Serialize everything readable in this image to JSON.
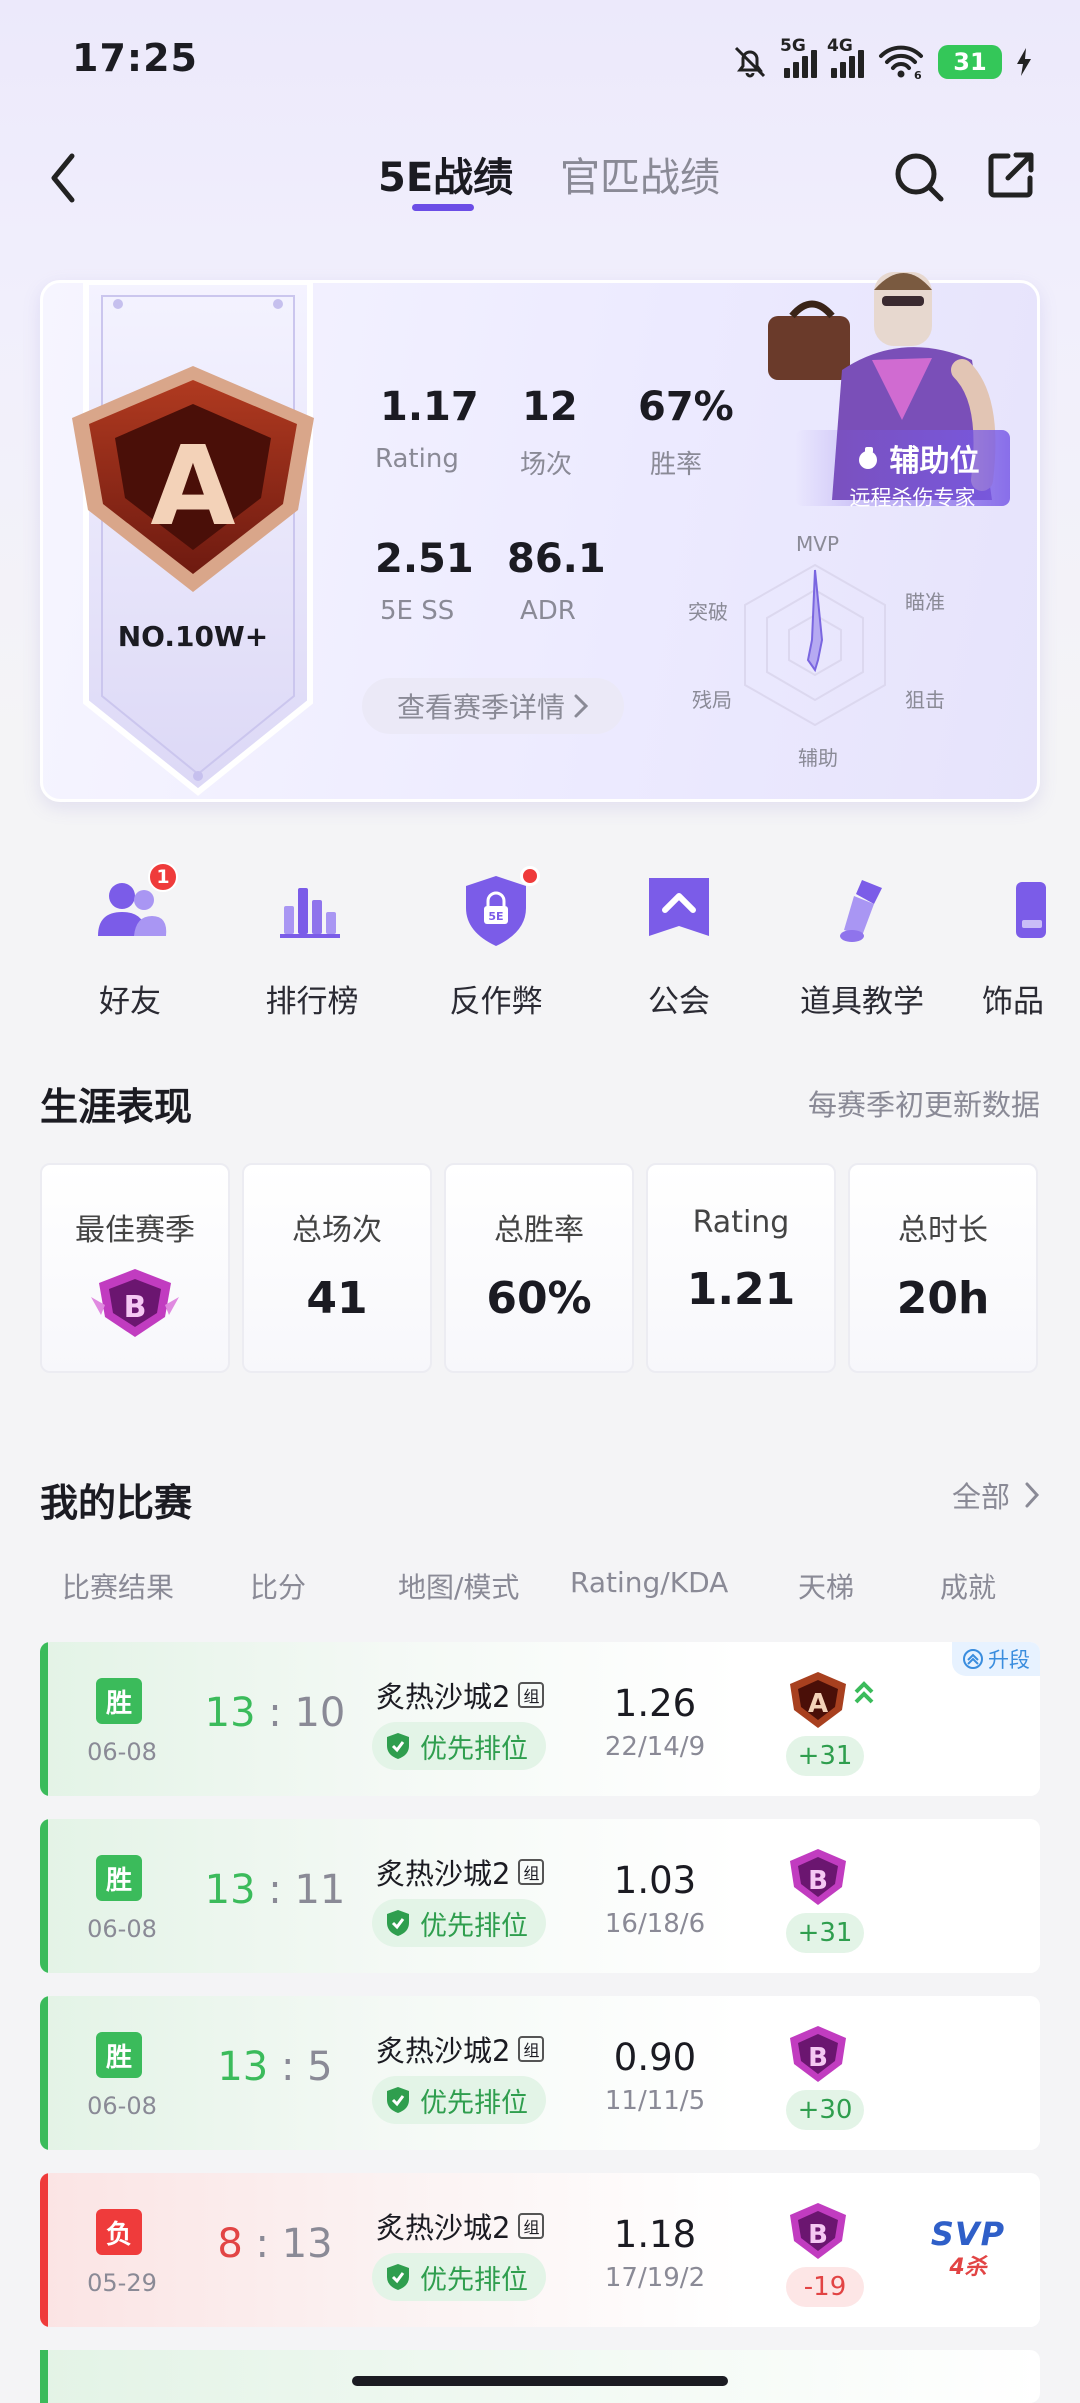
{
  "status_bar": {
    "time": "17:25",
    "signal1": "5G",
    "signal2": "4G",
    "wifi_sub": "6",
    "battery": "31"
  },
  "header": {
    "tabs": [
      {
        "label": "5E战绩",
        "active": true
      },
      {
        "label": "官匹战绩",
        "active": false
      }
    ]
  },
  "profile": {
    "rank_letter": "A",
    "rank_position": "NO.10W+",
    "stats": [
      {
        "value": "1.17",
        "label": "Rating"
      },
      {
        "value": "12",
        "label": "场次"
      },
      {
        "value": "67%",
        "label": "胜率"
      },
      {
        "value": "2.51",
        "label": "5E SS"
      },
      {
        "value": "86.1",
        "label": "ADR"
      }
    ],
    "detail_button": "查看赛季详情",
    "role": {
      "title": "辅助位",
      "subtitle": "远程杀伤专家"
    },
    "radar_labels": [
      "MVP",
      "瞄准",
      "狙击",
      "辅助",
      "残局",
      "突破"
    ]
  },
  "quick_menu": [
    {
      "label": "好友",
      "icon": "friends-icon",
      "badge": "1"
    },
    {
      "label": "排行榜",
      "icon": "leaderboard-icon"
    },
    {
      "label": "反作弊",
      "icon": "anti-cheat-shield-icon",
      "dot": true,
      "icon_text": "5E"
    },
    {
      "label": "公会",
      "icon": "guild-icon"
    },
    {
      "label": "道具教学",
      "icon": "grenade-icon"
    },
    {
      "label": "饰品",
      "icon": "skins-icon"
    }
  ],
  "career": {
    "title": "生涯表现",
    "note": "每赛季初更新数据",
    "cards": [
      {
        "title": "最佳赛季",
        "badge": "B"
      },
      {
        "title": "总场次",
        "value": "41"
      },
      {
        "title": "总胜率",
        "value": "60%"
      },
      {
        "title": "Rating",
        "value": "1.21"
      },
      {
        "title": "总时长",
        "value": "20h"
      }
    ]
  },
  "matches": {
    "title": "我的比赛",
    "all_link": "全部",
    "columns": [
      "比赛结果",
      "比分",
      "地图/模式",
      "Rating/KDA",
      "天梯",
      "成就"
    ],
    "rows": [
      {
        "result": "胜",
        "date": "06-08",
        "score_a": "13",
        "score_b": "10",
        "map": "炙热沙城2",
        "group": "组",
        "mode": "优先排位",
        "rating": "1.26",
        "kda": "22/14/9",
        "rank_badge": "A",
        "points": "+31",
        "promo": "升段"
      },
      {
        "result": "胜",
        "date": "06-08",
        "score_a": "13",
        "score_b": "11",
        "map": "炙热沙城2",
        "group": "组",
        "mode": "优先排位",
        "rating": "1.03",
        "kda": "16/18/6",
        "rank_badge": "B",
        "points": "+31"
      },
      {
        "result": "胜",
        "date": "06-08",
        "score_a": "13",
        "score_b": "5",
        "map": "炙热沙城2",
        "group": "组",
        "mode": "优先排位",
        "rating": "0.90",
        "kda": "11/11/5",
        "rank_badge": "B",
        "points": "+30"
      },
      {
        "result": "负",
        "date": "05-29",
        "score_a": "8",
        "score_b": "13",
        "map": "炙热沙城2",
        "group": "组",
        "mode": "优先排位",
        "rating": "1.18",
        "kda": "17/19/2",
        "rank_badge": "B",
        "points": "-19",
        "achievement": "SVP",
        "achievement_sub": "4杀"
      }
    ]
  },
  "colors": {
    "accent": "#6b4de6",
    "win": "#3bbb5b",
    "loss": "#e24444"
  }
}
